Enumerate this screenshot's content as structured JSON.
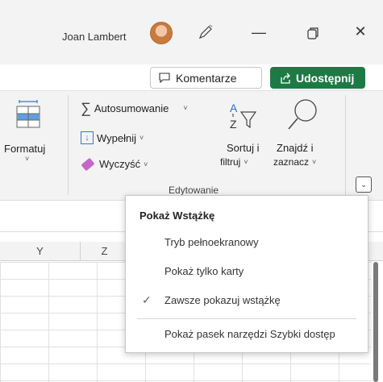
{
  "titlebar": {
    "user_name": "Joan Lambert",
    "icons": [
      "avatar",
      "pen-icon",
      "minimize-icon",
      "restore-icon",
      "close-icon"
    ],
    "minimize": "—",
    "close": "✕"
  },
  "actions": {
    "comments_label": "Komentarze",
    "share_label": "Udostępnij",
    "share_color": "#1e7a45"
  },
  "ribbon": {
    "formatuj": "Formatuj",
    "autosum": "Autosumowanie",
    "fill": "Wypełnij",
    "clear": "Wyczyść",
    "sort_line1": "Sortuj i",
    "sort_line2": "filtruj",
    "find_line1": "Znajdź i",
    "find_line2": "zaznacz",
    "group_label": "Edytowanie",
    "caret": "⌄",
    "small_caret": "˅"
  },
  "sheet": {
    "columns": [
      "Y",
      "Z"
    ]
  },
  "menu": {
    "title": "Pokaż Wstążkę",
    "items": [
      {
        "label": "Tryb pełnoekranowy",
        "checked": false
      },
      {
        "label": "Pokaż tylko karty",
        "checked": false
      },
      {
        "label": "Zawsze pokazuj wstążkę",
        "checked": true
      },
      {
        "label": "Pokaż pasek narzędzi Szybki dostęp",
        "checked": false
      }
    ],
    "checkmark": "✓"
  }
}
